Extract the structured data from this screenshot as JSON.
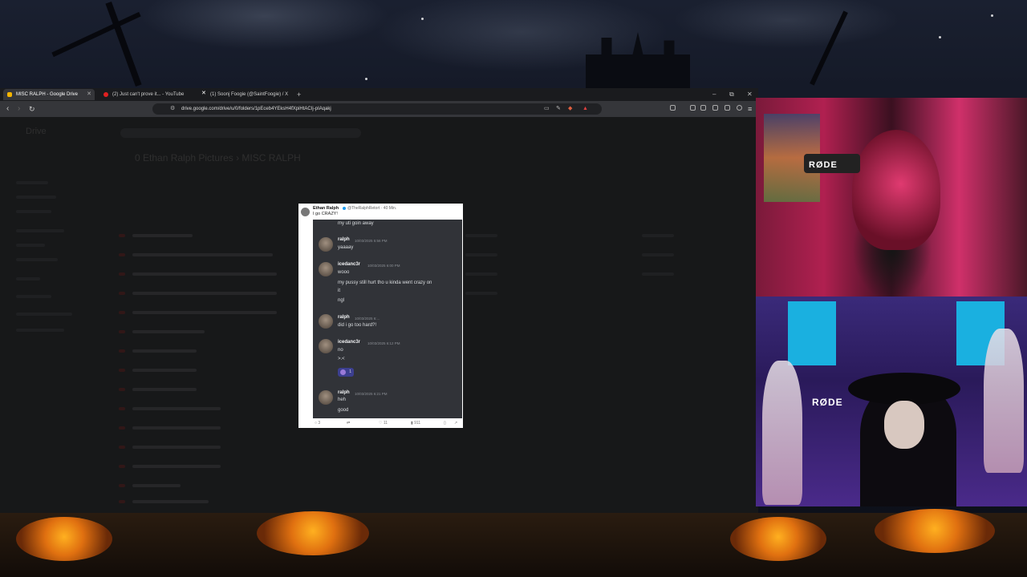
{
  "browser": {
    "tabs": [
      {
        "label": "MISC RALPH - Google Drive",
        "icon": "google-drive-icon",
        "active": true
      },
      {
        "label": "(2) Just can't prove it... - YouTube",
        "icon": "youtube-icon",
        "active": false
      },
      {
        "label": "(1) Soonj Foogie (@SaintFoogie) / X",
        "icon": "x-icon",
        "active": false
      }
    ],
    "new_tab": "+",
    "url": "drive.google.com/drive/u/0/folders/1pEceb4YEksH4fXpiHtACIj-pIAqakj",
    "window_controls": {
      "minimize": "–",
      "restore": "⧉",
      "close": "✕"
    }
  },
  "drive_background": {
    "title_path": "0 Ethan Ralph Pictures  ›  MISC RALPH",
    "app_name": "Drive"
  },
  "post": {
    "author": "Ethan Ralph",
    "handle": "@TheRalphRetort · 40 Min.",
    "caption": "I go CRAZY!",
    "footer": {
      "replies": "3",
      "retweets": "",
      "likes": "11",
      "views": "911"
    }
  },
  "chat": {
    "top_line": "my uti goin away",
    "messages": [
      {
        "user": "ralph",
        "time": "10/03/2025 5:56 PM",
        "lines": [
          "yaaaay"
        ]
      },
      {
        "user": "icedanc3r",
        "time": "10/03/2025 6:00 PM",
        "lines": [
          "wooo",
          "my pussy still hurt tho u kinda went crazy on",
          "it",
          "ngl"
        ]
      },
      {
        "user": "ralph",
        "time": "10/03/2025 6:...",
        "lines": [
          "did i go too hard?!"
        ]
      },
      {
        "user": "icedanc3r",
        "time": "10/03/2025 6:12 PM",
        "lines": [
          "no",
          ">.<"
        ]
      },
      {
        "user": "ralph",
        "time": "10/03/2025 6:21 PM",
        "lines": [
          "heh",
          "good"
        ]
      }
    ],
    "reaction": {
      "count": "1"
    }
  },
  "webcam": {
    "mic_brand": "RØDE"
  },
  "colors": {
    "accent_discord": "#313338",
    "reaction": "#3c3f8f",
    "verified": "#1d9bf0"
  }
}
